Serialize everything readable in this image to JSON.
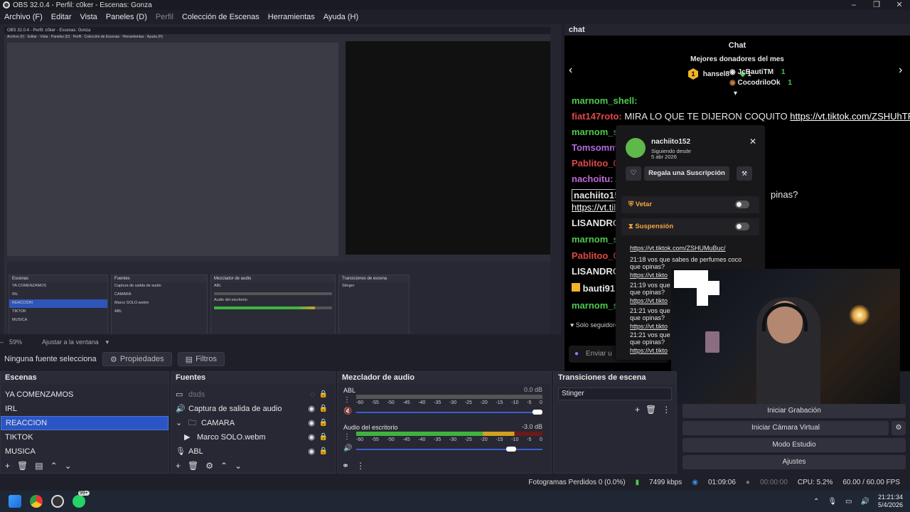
{
  "window": {
    "title": "OBS 32.0.4 - Perfil: c0ker - Escenas: Gonza"
  },
  "menu": [
    "Archivo (F)",
    "Editar",
    "Vista",
    "Paneles (D)",
    "Perfil",
    "Colección de Escenas",
    "Herramientas",
    "Ayuda (H)"
  ],
  "preview": {
    "zoom": "59%",
    "fit_label": "Ajustar a la ventana"
  },
  "source_bar": {
    "none_selected": "Ninguna fuente seleccionada",
    "properties": "Propiedades",
    "filters": "Filtros"
  },
  "chat": {
    "dock_title": "chat",
    "header": "Chat",
    "donors_title": "Mejores donadores del mes",
    "donors": [
      {
        "rank": "1",
        "name": "hansel8",
        "amount": "1"
      },
      {
        "rank": "",
        "name": "JcBautiTM",
        "amount": "1"
      },
      {
        "rank": "",
        "name": "CocodriloOk",
        "amount": "1"
      }
    ],
    "messages": [
      {
        "user": "marnom_shell:",
        "text": "",
        "color": "#4ec94e"
      },
      {
        "user": "fiat147roto:",
        "text": "MIRA LO QUE TE DIJERON COQUITO",
        "link": "https://vt.tiktok.com/ZSHUhTRwv/",
        "color": "#e04848"
      },
      {
        "user": "marnom_sl",
        "text": "",
        "color": "#4ec94e"
      },
      {
        "user": "Tomsomm",
        "text": "",
        "color": "#b46ce0"
      },
      {
        "user": "Pablitoo_0:",
        "text": "",
        "color": "#e04848"
      },
      {
        "user": "nachoitu:",
        "text": "A",
        "color": "#c06ad8"
      },
      {
        "user": "nachiito152",
        "text": "pinas?",
        "color": "#ffffff"
      },
      {
        "user": "",
        "text": "",
        "link": "https://vt.til",
        "color": "#ffffff"
      },
      {
        "user": "LISANDRO",
        "text": "",
        "color": "#ffffff"
      },
      {
        "user": "marnom_sl",
        "text": "",
        "color": "#4ec94e"
      },
      {
        "user": "Pablitoo_0:",
        "text": "",
        "color": "#e04848"
      },
      {
        "user": "LISANDRO",
        "text": "",
        "color": "#ffffff"
      },
      {
        "user": "bauti91",
        "text": "",
        "color": "#ffffff"
      },
      {
        "user": "marnom_sl",
        "text": "",
        "color": "#4ec94e"
      }
    ],
    "followers_note": "Solo seguidores",
    "send_placeholder": "Enviar u"
  },
  "user_card": {
    "name": "nachiito152",
    "since_label": "Siguiendo desde",
    "since_date": "5 abr 2026",
    "gift_label": "Regala una Suscripción",
    "mute_label": "Vetar",
    "timeout_label": "Suspensión",
    "link": "https://vt.tiktok.com/ZSHUMuBuc/",
    "history": [
      {
        "time": "21:18",
        "text": "vos que sabes de perfumes coco que opinas?",
        "link": "https://vt.tikto"
      },
      {
        "time": "21:19",
        "text": "vos que que opinas?",
        "link": "https://vt.tikto"
      },
      {
        "time": "21:21",
        "text": "vos que que opinas?",
        "link": "https://vt.tikto"
      },
      {
        "time": "21:21",
        "text": "vos que que opinas?",
        "link": "https://vt.tikto"
      }
    ]
  },
  "scenes": {
    "title": "Escenas",
    "items": [
      "YA COMENZAMOS",
      "IRL",
      "REACCION",
      "TIKTOK",
      "MUSICA"
    ],
    "selected_index": 2
  },
  "sources": {
    "title": "Fuentes",
    "items": [
      {
        "name": "dsds",
        "icon": "monitor-icon",
        "dim": true
      },
      {
        "name": "Captura de salida de audio",
        "icon": "speaker-icon",
        "dim": false
      },
      {
        "name": "CAMARA",
        "icon": "folder-icon",
        "dim": false
      },
      {
        "name": "Marco SOLO.webm",
        "icon": "play-icon",
        "dim": false
      },
      {
        "name": "ABL",
        "icon": "mic-icon",
        "dim": false
      }
    ]
  },
  "mixer": {
    "title": "Mezclador de audio",
    "channels": [
      {
        "name": "ABL",
        "db": "0.0 dB",
        "level": 0.0,
        "volume": 1.0
      },
      {
        "name": "Audio del escritorio",
        "db": "-3.0 dB",
        "level": 0.85,
        "volume": 0.85
      }
    ],
    "scale": [
      "-60",
      "-55",
      "-50",
      "-45",
      "-40",
      "-35",
      "-30",
      "-25",
      "-20",
      "-15",
      "-10",
      "-5",
      "0"
    ]
  },
  "transitions": {
    "title": "Transiciones de escena",
    "selected": "Stinger"
  },
  "controls": [
    "Iniciar Grabación",
    "Iniciar Cámara Virtual",
    "Modo Estudio",
    "Ajustes"
  ],
  "status": {
    "dropped": "Fotogramas Perdidos 0 (0.0%)",
    "bitrate": "7499 kbps",
    "live_time": "01:09:06",
    "rec_time": "00:00:00",
    "cpu": "CPU: 5.2%",
    "fps": "60.00 / 60.00 FPS"
  },
  "taskbar": {
    "badge": "99+",
    "time": "21:21:34",
    "date": "5/4/2026"
  }
}
